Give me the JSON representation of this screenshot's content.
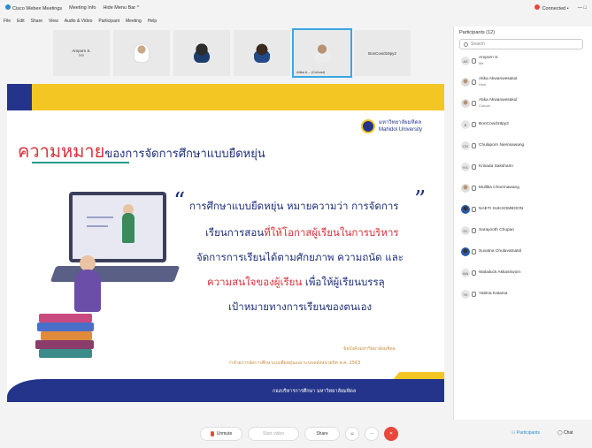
{
  "titlebar": {
    "app_name": "Cisco Webex Meetings",
    "meeting_info": "Meeting Info",
    "hide_menu": "Hide Menu Bar ^",
    "connection": "Connected •",
    "window_controls": "— □"
  },
  "menubar": {
    "items": [
      "File",
      "Edit",
      "Share",
      "View",
      "Audio & Video",
      "Participant",
      "Meeting",
      "Help"
    ]
  },
  "thumbnails": [
    {
      "label": "Amporn S.",
      "sub": "Me",
      "type": "text"
    },
    {
      "label": "",
      "type": "photo1"
    },
    {
      "label": "",
      "type": "photo2"
    },
    {
      "label": "",
      "type": "photo3"
    },
    {
      "label": "Atika A... (Cohost)",
      "type": "photo4",
      "active": true
    },
    {
      "label": "BonCovid19py2",
      "type": "text"
    }
  ],
  "slide": {
    "university_name_line1": "มหาวิทยาลัยมหิดล",
    "university_name_line2": "Mahidol University",
    "title_red": "ความหมาย",
    "title_blue": "ของการจัดการศึกษาแบบยืดหยุ่น",
    "open_quote": "“",
    "close_quote": "”",
    "quote_line1": "การศึกษาแบบยืดหยุ่น หมายความว่า การจัดการ",
    "quote_line2_blue": "เรียนการสอน",
    "quote_line2_red": "ที่ให้โอกาสผู้เรียนในการบริหาร",
    "quote_line3": "จัดการการเรียนได้ตามศักยภาพ ความถนัด และ",
    "quote_line4_red": "ความสนใจของผู้เรียน",
    "quote_line4_blue": " เพื่อให้ผู้เรียนบรรลุ",
    "quote_line5": "เป้าหมายทางการเรียนของตนเอง",
    "source_line1": "ข้อบังคับมหาวิทยาลัยมหิดล",
    "source_line2": "ว่าด้วยการจัดการศึกษาแบบยืดหยุ่นและระบบคลังหน่วยกิต พ.ศ. 2563",
    "footer_org": "กองบริหารการศึกษา มหาวิทยาลัยมหิดล"
  },
  "participants": {
    "header": "Participants (12)",
    "search_placeholder": "Search",
    "list": [
      {
        "initials": "AS",
        "name": "Amporn S.",
        "role": "Me",
        "avatar": "initials"
      },
      {
        "initials": "",
        "name": "Atika Akwanwesakul",
        "role": "Host",
        "avatar": "photo"
      },
      {
        "initials": "",
        "name": "Atika Akwanwesakul",
        "role": "Cohost",
        "avatar": "photo"
      },
      {
        "initials": "B",
        "name": "BonCovid19py2",
        "role": "",
        "avatar": "initials"
      },
      {
        "initials": "CN",
        "name": "Chulaporn Niemsawang",
        "role": "",
        "avatar": "initials"
      },
      {
        "initials": "KS",
        "name": "Krisada Saksharin",
        "role": "",
        "avatar": "initials"
      },
      {
        "initials": "",
        "name": "Mullika Chomnawang",
        "role": "",
        "avatar": "photo"
      },
      {
        "initials": "",
        "name": "NAETI SUKSOMBOON",
        "role": "",
        "avatar": "blue"
      },
      {
        "initials": "SC",
        "name": "Sarayooth Chupan",
        "role": "",
        "avatar": "initials"
      },
      {
        "initials": "",
        "name": "Suvatna Chulavatnatol",
        "role": "",
        "avatar": "blue"
      },
      {
        "initials": "WA",
        "name": "Walailuck Akkasriworn",
        "role": "",
        "avatar": "initials"
      },
      {
        "initials": "YK",
        "name": "Yatima Katama",
        "role": "",
        "avatar": "initials"
      }
    ]
  },
  "controls": {
    "unmute": "Unmute",
    "start_video": "Start video",
    "share": "Share",
    "participants": "Participants",
    "chat": "Chat"
  }
}
